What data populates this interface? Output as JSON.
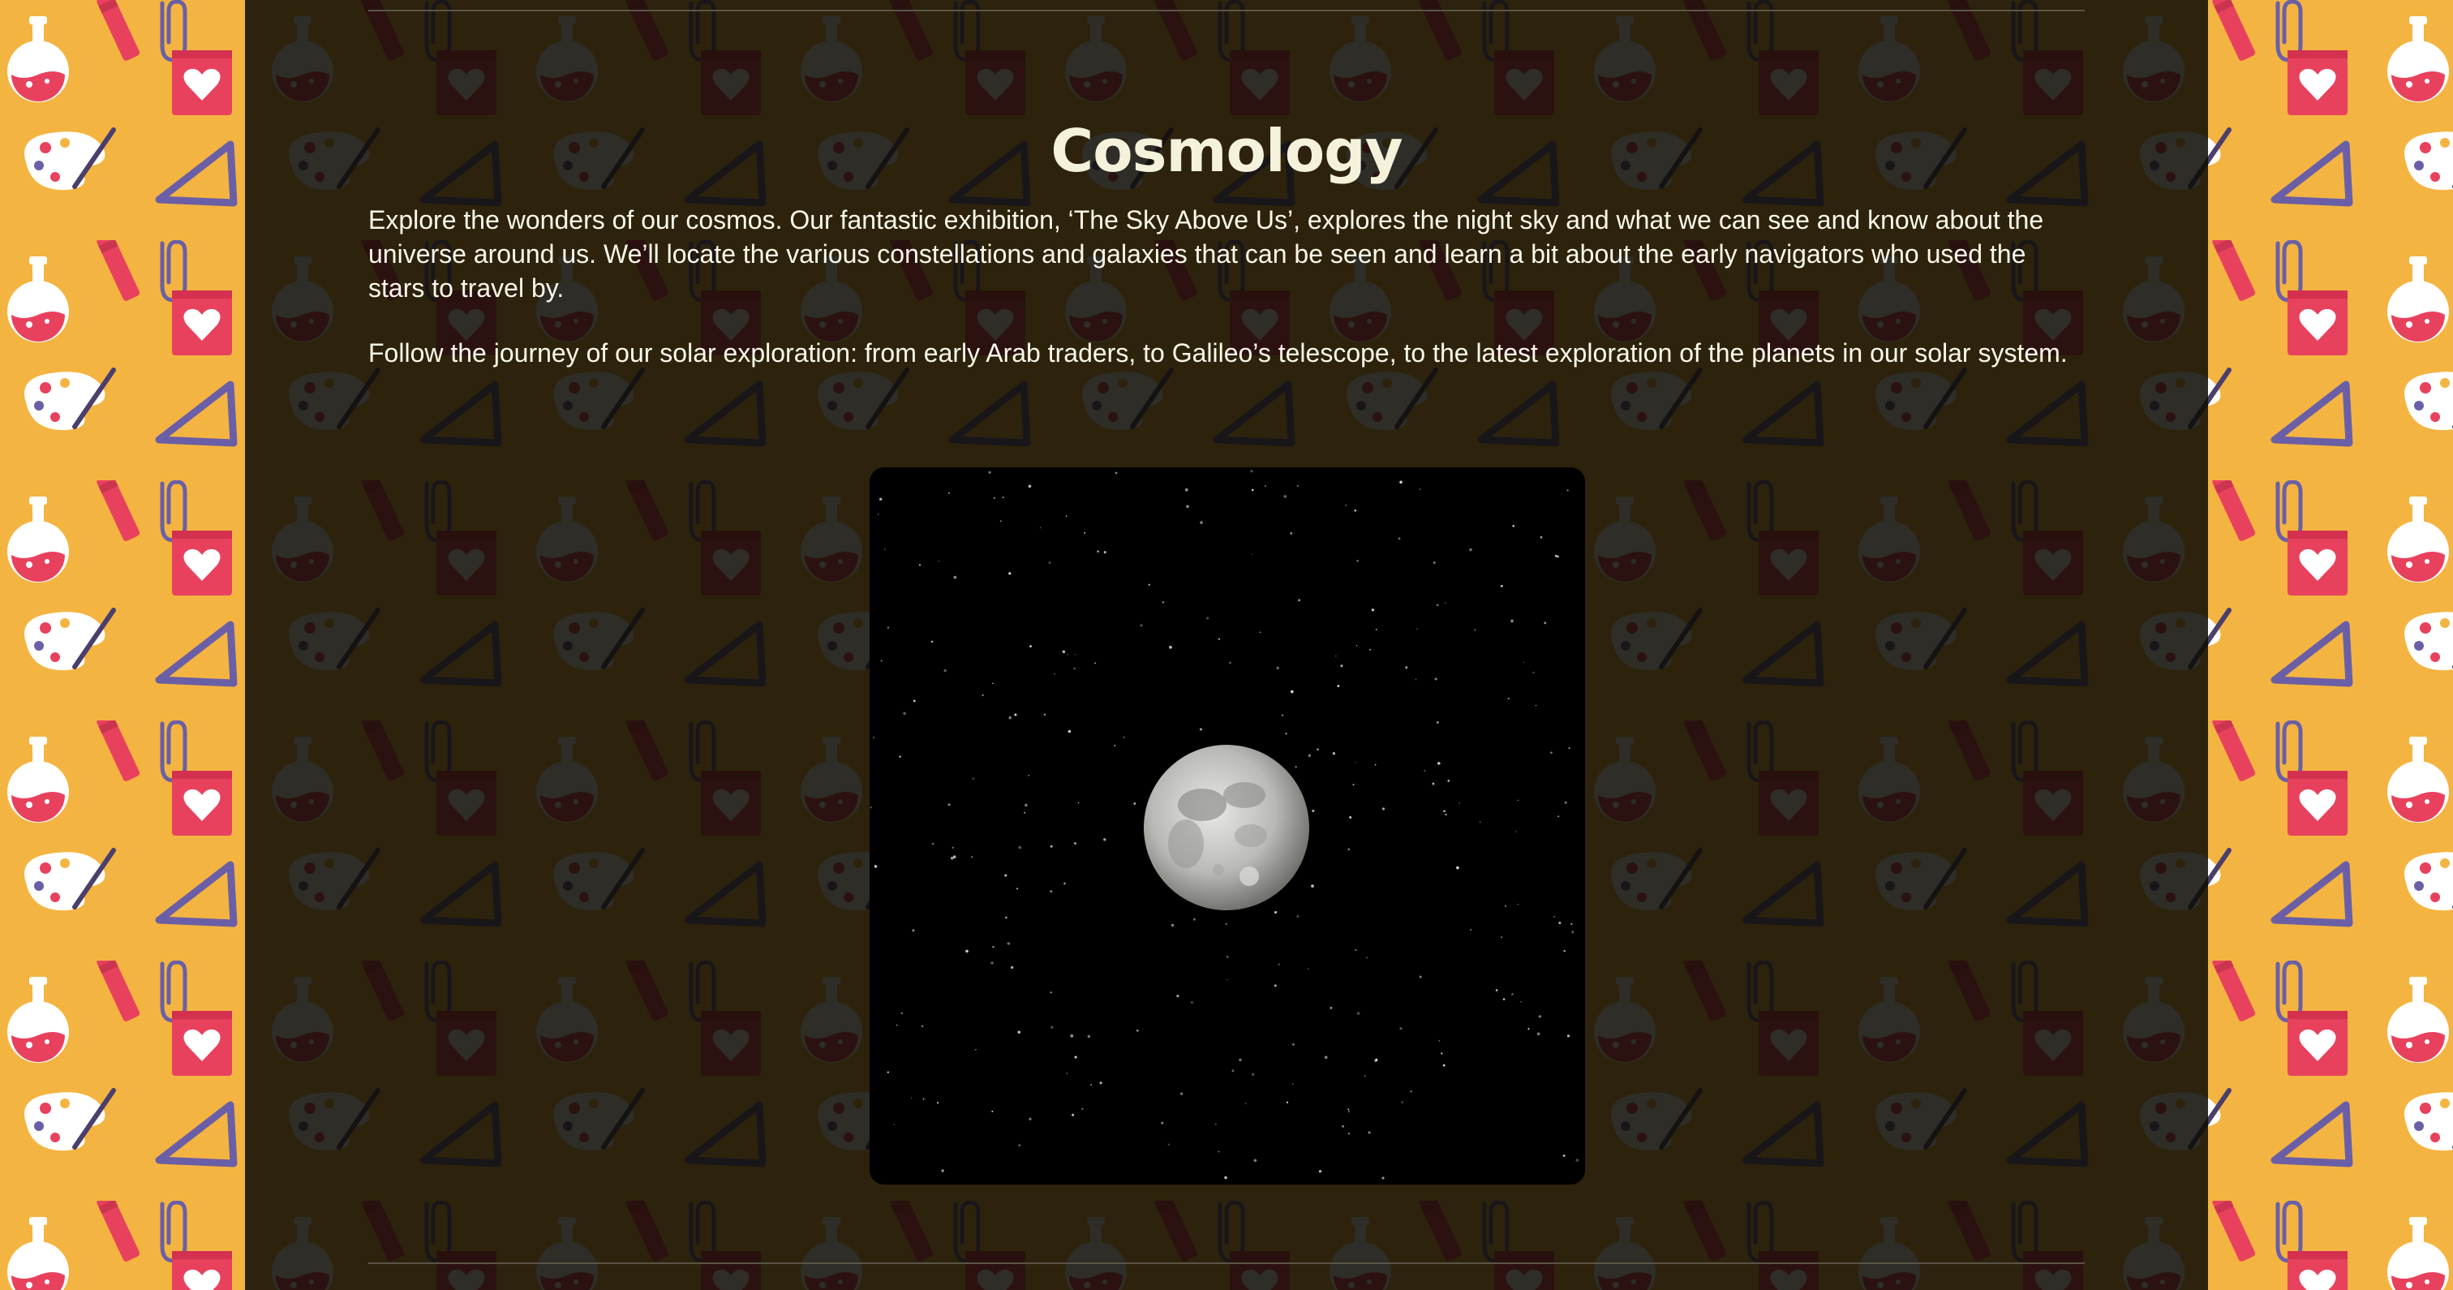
{
  "page": {
    "title": "Cosmology",
    "paragraphs": [
      "Explore the wonders of our cosmos. Our fantastic exhibition, ‘The Sky Above Us’, explores the night sky and what we can see and know about the universe around us. We’ll locate the various constellations and galaxies that can be seen and learn a bit about the early navigators who used the stars to travel by.",
      "Follow the journey of our solar exploration: from early Arab traders, to Galileo’s telescope, to the latest exploration of the planets in our solar system."
    ]
  },
  "image": {
    "subject": "full moon in starry night sky",
    "icon": "moon-image"
  },
  "background": {
    "pattern_icons": [
      "flask-icon",
      "pencil-icon",
      "paperclip-icon",
      "notepad-heart-icon",
      "paint-palette-icon",
      "set-square-icon"
    ]
  },
  "colors": {
    "background_orange": "#f4b441",
    "panel": "#0c0a04",
    "title_text": "#f5f2dc",
    "body_text": "#fbf8ea",
    "rule": "#5b5446"
  }
}
